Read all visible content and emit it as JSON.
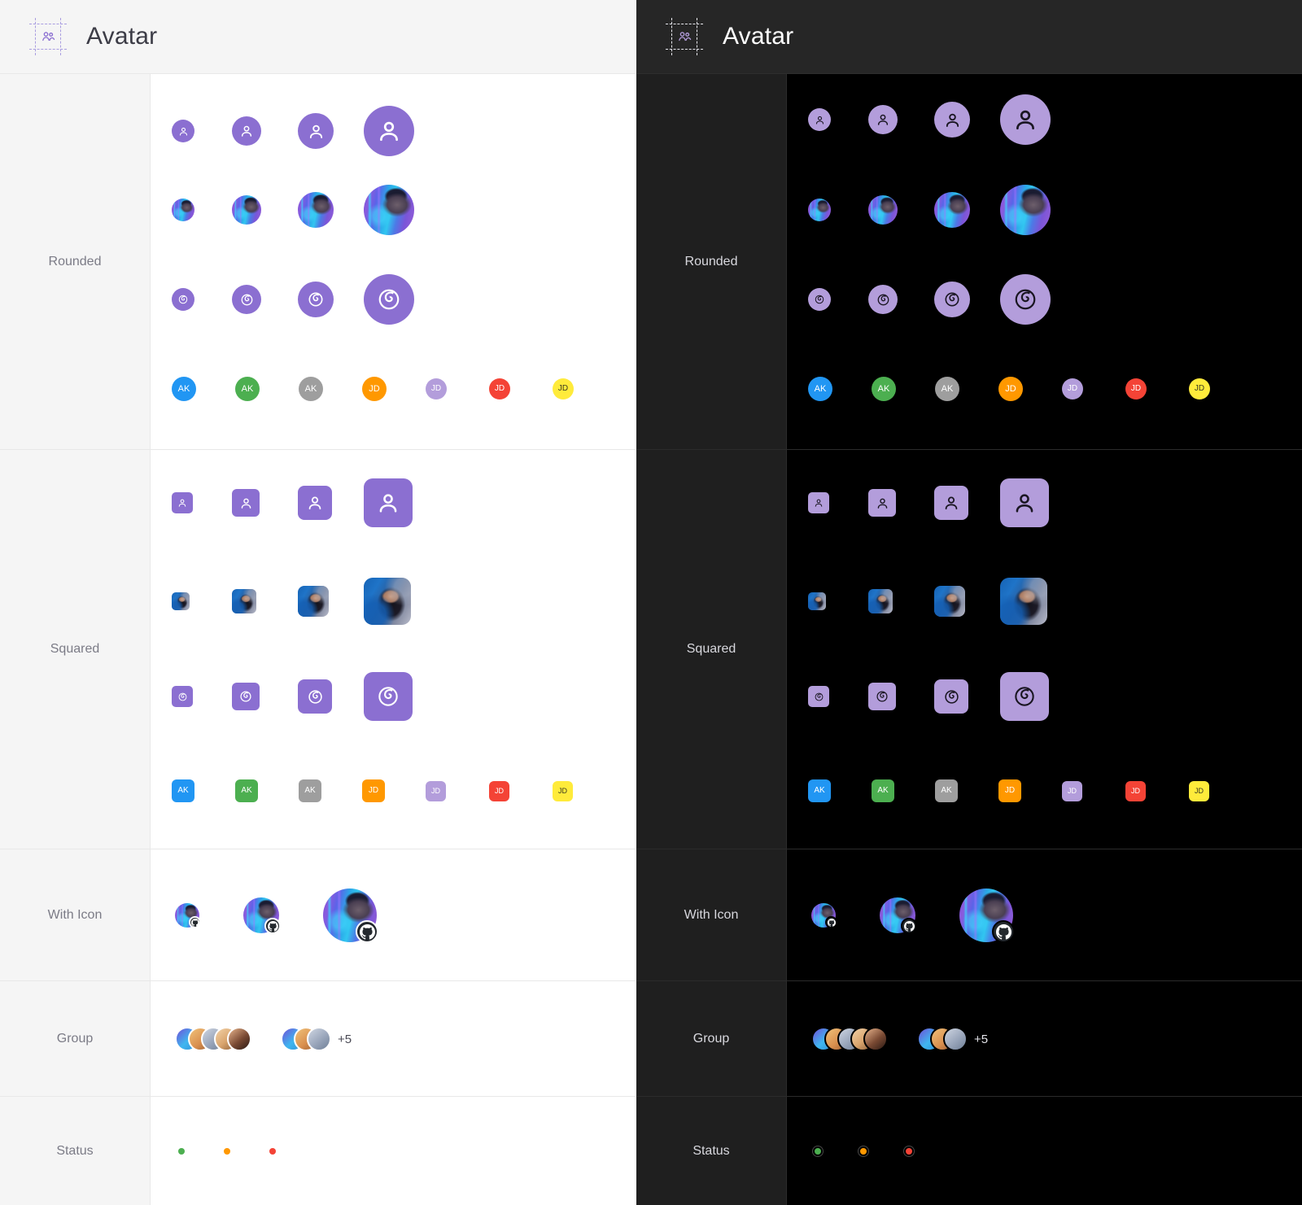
{
  "themes": [
    {
      "name": "light",
      "title": "Avatar",
      "icon": "people-icon"
    },
    {
      "name": "dark",
      "title": "Avatar",
      "icon": "people-icon"
    }
  ],
  "rows": [
    {
      "key": "rounded",
      "label": "Rounded"
    },
    {
      "key": "squared",
      "label": "Squared"
    },
    {
      "key": "with_icon",
      "label": "With Icon"
    },
    {
      "key": "group",
      "label": "Group"
    },
    {
      "key": "status",
      "label": "Status"
    }
  ],
  "sizes": {
    "xs": 18,
    "sm": 24,
    "md": 32,
    "lg": 48
  },
  "placeholder": {
    "icon": "user-icon",
    "fill_light": "#8b6fd1",
    "fill_dark": "#b39ddb",
    "glyph_light": "#ffffff",
    "glyph_dark": "#1a1622",
    "sizes": [
      28,
      36,
      44,
      62
    ]
  },
  "brand": {
    "icon": "debian-swirl-icon",
    "fill_light": "#8b6fd1",
    "fill_dark": "#b39ddb",
    "sizes": [
      28,
      36,
      44,
      62
    ]
  },
  "photos": {
    "rounded": {
      "alt": "man-with-beanie-neon-portrait",
      "sizes": [
        28,
        36,
        44,
        62
      ]
    },
    "squared": {
      "alt": "woman-dark-hair-blue-portrait",
      "sizes": [
        22,
        30,
        38,
        58
      ]
    }
  },
  "initials": [
    {
      "text": "AK",
      "color": "#2196f3",
      "text_color": "#ffffff"
    },
    {
      "text": "AK",
      "color": "#4caf50",
      "text_color": "#ffffff"
    },
    {
      "text": "AK",
      "color": "#9e9e9e",
      "text_color": "#ffffff"
    },
    {
      "text": "JD",
      "color": "#ff9800",
      "text_color": "#ffffff"
    },
    {
      "text": "JD",
      "color": "#b39ddb",
      "text_color": "#ffffff"
    },
    {
      "text": "JD",
      "color": "#f44336",
      "text_color": "#ffffff"
    },
    {
      "text": "JD",
      "color": "#ffeb3b",
      "text_color": "#3a3a20"
    }
  ],
  "with_icon": {
    "badge_icon": "github-icon",
    "badge_color": "#24292e",
    "sizes": [
      30,
      44,
      66
    ],
    "badge_sizes": [
      15,
      20,
      28
    ]
  },
  "group": {
    "stack_full": {
      "count": 5,
      "size": 30
    },
    "stack_overflow": {
      "count": 3,
      "size": 30,
      "more_label": "+5"
    }
  },
  "status": [
    {
      "name": "online",
      "color": "#4caf50"
    },
    {
      "name": "away",
      "color": "#ff9800"
    },
    {
      "name": "busy",
      "color": "#f44336"
    }
  ]
}
